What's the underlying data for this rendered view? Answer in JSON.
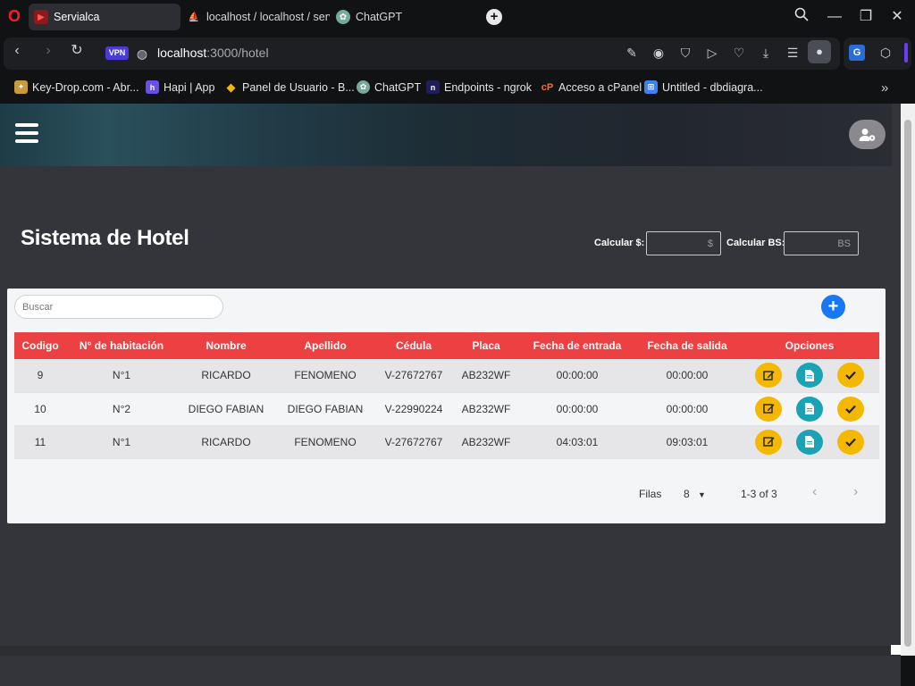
{
  "browser": {
    "tabs": [
      {
        "label": "Servialca",
        "active": true
      },
      {
        "label": "localhost / localhost / serv",
        "active": false
      },
      {
        "label": "ChatGPT",
        "active": false
      }
    ],
    "url_host": "localhost",
    "url_rest": ":3000/hotel",
    "vpn_badge": "VPN",
    "bookmarks": [
      {
        "label": "Key-Drop.com - Abr...",
        "icon": "keydrop-icon",
        "color": "#c89b3c"
      },
      {
        "label": "Hapi | App",
        "icon": "hapi-icon",
        "color": "#6b4cf0"
      },
      {
        "label": "Panel de Usuario - B...",
        "icon": "binance-icon",
        "color": "#f0b90b"
      },
      {
        "label": "ChatGPT",
        "icon": "chatgpt-icon",
        "color": "#74aa9c"
      },
      {
        "label": "Endpoints - ngrok",
        "icon": "ngrok-icon",
        "color": "#1f1e5d"
      },
      {
        "label": "Acceso a cPanel",
        "icon": "cpanel-icon",
        "color": "#ff6c2c"
      },
      {
        "label": "Untitled - dbdiagra...",
        "icon": "dbdiagram-icon",
        "color": "#3b82f6"
      }
    ]
  },
  "app": {
    "title": "Sistema de Hotel",
    "calc_usd_label": "Calcular $:",
    "calc_usd_placeholder": "$",
    "calc_bs_label": "Calcular BS:",
    "calc_bs_placeholder": "BS",
    "search_placeholder": "Buscar",
    "columns": [
      "Codigo",
      "N° de habitación",
      "Nombre",
      "Apellido",
      "Cédula",
      "Placa",
      "Fecha de entrada",
      "Fecha de salida",
      "Opciones"
    ],
    "rows": [
      {
        "codigo": "9",
        "habitacion": "N°1",
        "nombre": "RICARDO",
        "apellido": "FENOMENO",
        "cedula": "V-27672767",
        "placa": "AB232WF",
        "entrada": "00:00:00",
        "salida": "00:00:00"
      },
      {
        "codigo": "10",
        "habitacion": "N°2",
        "nombre": "DIEGO FABIAN",
        "apellido": "DIEGO FABIAN",
        "cedula": "V-22990224",
        "placa": "AB232WF",
        "entrada": "00:00:00",
        "salida": "00:00:00"
      },
      {
        "codigo": "11",
        "habitacion": "N°1",
        "nombre": "RICARDO",
        "apellido": "FENOMENO",
        "cedula": "V-27672767",
        "placa": "AB232WF",
        "entrada": "04:03:01",
        "salida": "09:03:01"
      }
    ],
    "pagination": {
      "rows_label": "Filas",
      "rows_per_page": "8",
      "range": "1-3 of 3"
    },
    "colors": {
      "table_header": "#ec4143",
      "edit_button": "#f5b800",
      "doc_button": "#1aa3b5",
      "add_button": "#1877f2"
    }
  }
}
